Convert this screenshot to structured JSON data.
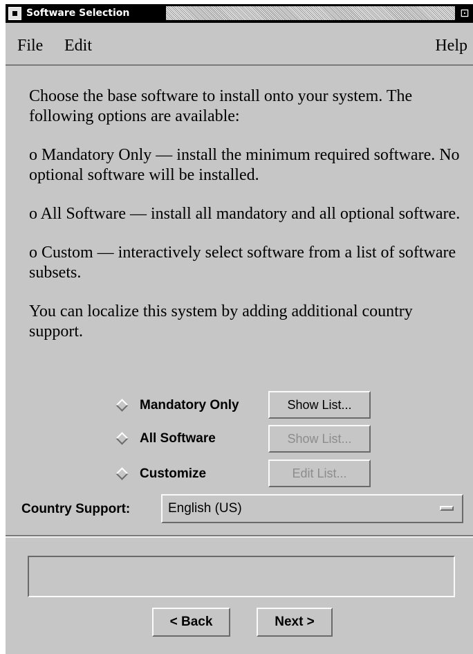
{
  "window": {
    "title": "Software Selection",
    "maximize_glyph": "⊡"
  },
  "menubar": {
    "file": "File",
    "edit": "Edit",
    "help": "Help"
  },
  "description": [
    "Choose the base software to install onto your system. The following options are available:",
    "o  Mandatory Only –– install the minimum required software.  No optional software will be installed.",
    "o  All Software –– install all mandatory and all optional software.",
    "o  Custom –– interactively select software from a list of software subsets.",
    "You can localize this system by adding additional country support."
  ],
  "options": [
    {
      "label": "Mandatory Only",
      "button": "Show List...",
      "button_enabled": true
    },
    {
      "label": "All Software",
      "button": "Show List...",
      "button_enabled": false
    },
    {
      "label": "Customize",
      "button": "Edit List...",
      "button_enabled": false
    }
  ],
  "country_support": {
    "label": "Country Support:",
    "value": "English (US)"
  },
  "status_message": "",
  "navigation": {
    "back": "< Back",
    "next": "Next >"
  },
  "colors": {
    "background": "#c6c6c6",
    "title_bar": "#000000",
    "disabled_text": "#8c8c8c"
  }
}
